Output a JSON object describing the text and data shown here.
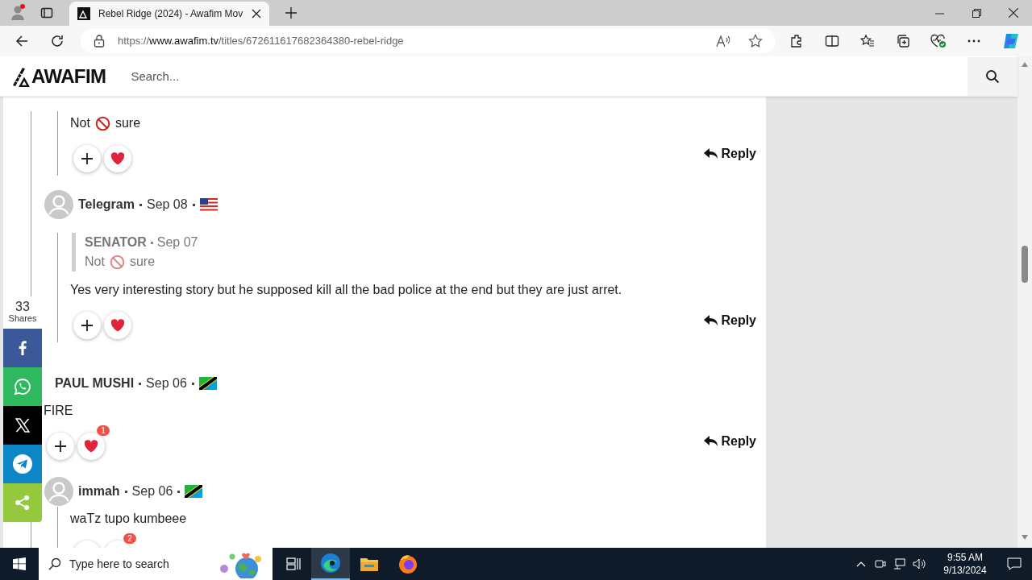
{
  "browser": {
    "tabs": [
      {
        "title": "Rebel Ridge (2024) - Awafim Mov",
        "selected": true
      }
    ],
    "url": {
      "scheme": "https://",
      "host": "www.awafim.tv",
      "path": "/titles/672611617682364380-rebel-ridge"
    }
  },
  "site_header": {
    "logo": "AWAFIM",
    "search": {
      "placeholder": "Search..."
    }
  },
  "share_bar": {
    "count": "33",
    "label": "Shares",
    "buttons": [
      {
        "kind": "facebook"
      },
      {
        "kind": "whatsapp"
      },
      {
        "kind": "x"
      },
      {
        "kind": "telegram"
      },
      {
        "kind": "share"
      }
    ]
  },
  "comments": [
    {
      "children": [
        {
          "body": [
            {
              "kind": "text",
              "text": "Not"
            },
            {
              "kind": "prohibited"
            },
            {
              "kind": "text",
              "text": "sure"
            }
          ],
          "reply": "Reply"
        },
        {
          "author": "Telegram",
          "avatar": true,
          "date": "Sep 08",
          "flag": {
            "kind": "us"
          },
          "quote": {
            "author": "SENATOR",
            "date": "Sep 07",
            "body": [
              {
                "kind": "text",
                "text": "Not"
              },
              {
                "kind": "prohibited"
              },
              {
                "kind": "text",
                "text": "sure"
              }
            ]
          },
          "body": [
            {
              "kind": "text",
              "text": "Yes very interesting story but he supposed kill all the bad police at the end but they are just arret."
            }
          ],
          "reply": "Reply"
        }
      ]
    },
    {
      "author": "PAUL MUSHI",
      "date": "Sep 06",
      "flag": {
        "kind": "tz"
      },
      "body": [
        {
          "kind": "text",
          "text": "FIRE"
        }
      ],
      "likes": "1",
      "reply": "Reply",
      "children": [
        {
          "author": "immah",
          "avatar": true,
          "date": "Sep 06",
          "flag": {
            "kind": "tz"
          },
          "body": [
            {
              "kind": "text",
              "text": "waTz tupo kumbeee"
            }
          ],
          "likes": "2"
        }
      ]
    }
  ],
  "taskbar": {
    "search": {
      "placeholder": "Type here to search"
    },
    "clock": {
      "time": "9:55 AM",
      "date": "9/13/2024"
    }
  }
}
